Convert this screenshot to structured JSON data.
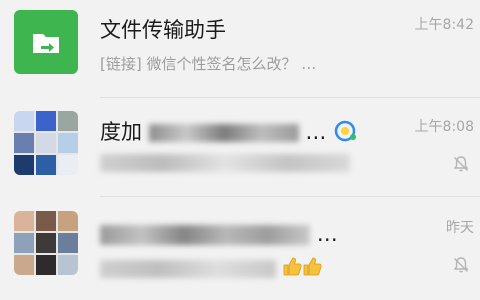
{
  "chats": [
    {
      "title": "文件传输助手",
      "preview": "[链接] 微信个性签名怎么改？ …",
      "time": "上午8:42",
      "avatar_icon": "folder-transfer-icon",
      "avatar_color": "#3fb54f"
    },
    {
      "title_visible": "度加",
      "title_suffix": "…",
      "time": "上午8:08",
      "muted": true,
      "avatar_icon": "group-avatar-grid"
    },
    {
      "title_suffix": "…",
      "time": "昨天",
      "muted": true,
      "avatar_icon": "group-avatar-grid",
      "preview_icon": "thumbs-up-icon"
    }
  ]
}
